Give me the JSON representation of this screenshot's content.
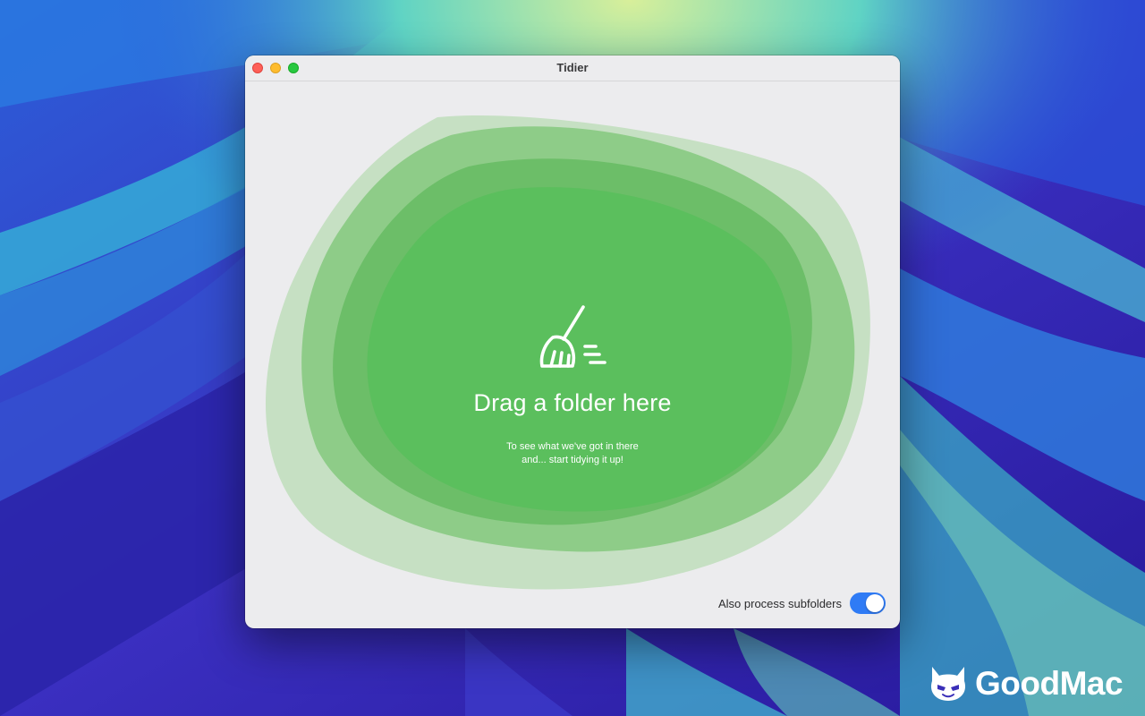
{
  "window": {
    "title": "Tidier"
  },
  "drop_zone": {
    "icon": "broom-icon",
    "title": "Drag a folder here",
    "subtitle_line1": "To see what we've got in there",
    "subtitle_line2": "and... start tidying it up!"
  },
  "options": {
    "subfolders_label": "Also process subfolders",
    "subfolders_enabled": true
  },
  "watermark": {
    "logo_icon": "goodmac-devil-logo-icon",
    "text": "GoodMac"
  },
  "colors": {
    "accent_green": "#5cc15e",
    "toggle_blue": "#2f7bf5",
    "close": "#fe5f57",
    "minimize": "#febc2e",
    "maximize": "#28c840"
  }
}
